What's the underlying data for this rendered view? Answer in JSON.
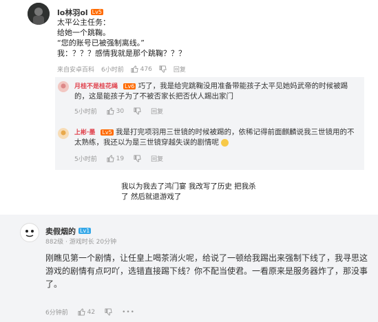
{
  "comment1": {
    "username": "lo林羽ol",
    "level": "Lv5",
    "text": "太平公主任务：\n给她一个跳鞠。\n“您的账号已被强制离线。”\n我：？？？感情我就是那个跳鞠？？？",
    "source": "来自安卓百科",
    "time": "6小时前",
    "likes": "476",
    "reply_label": "回复",
    "replies": [
      {
        "username": "月桂不是桂花绳",
        "level": "Lv6",
        "text": "巧了，我是给完跳鞠没用准备带能孩子太平见她妈武帝的时候被踢的，这是能孩子为了不被否家长把否伏人踢出家门",
        "time": "5小时前",
        "likes": "30",
        "reply_label": "回复"
      },
      {
        "username": "上彬·墨",
        "level": "Lv5",
        "text": "我是打完项羽用三世镜的时候被踢的，依稀记得前面麒麟说我三世镜用的不太熟练，我还以为是三世镜穿越失误的剧情呢",
        "time": "5小时前",
        "likes": "19",
        "reply_label": "回复"
      }
    ]
  },
  "overlay_text": "我以为我去了鸿门宴 我改写了历史 把我杀\n了  然后就退游戏了",
  "comment2": {
    "username": "卖假烟的",
    "level": "Lv1",
    "stats": "882级 · 游戏时长 20分钟",
    "text": "刚瞧见第一个剧情，让任皇上喝茶消火呢，给说了一顿给我踢出来强制下线了，我寻思这游戏的剧情有点叼吖，选错直接踢下线？你不配当使君。一看原来是服务器炸了，那没事了。",
    "time": "6分钟前",
    "likes": "42"
  },
  "colors": {
    "level_orange": "#ff6a00",
    "level_blue": "#33a7e8",
    "reply_name_red": "#e0434e"
  }
}
